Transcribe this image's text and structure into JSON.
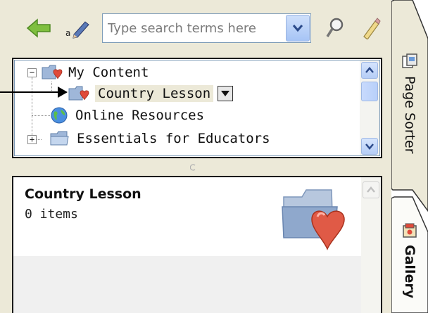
{
  "toolbar": {
    "back_icon": "back-arrow-icon",
    "rename_icon": "rename-pen-icon",
    "search": {
      "placeholder": "Type search terms here",
      "value": ""
    },
    "search_icon": "magnifier-icon",
    "clear_icon": "pencil-icon"
  },
  "tree": {
    "items": [
      {
        "label": "My Content",
        "icon": "folder-heart-icon",
        "expander": "−"
      },
      {
        "label": "Country Lesson",
        "icon": "folder-heart-icon",
        "selected": true
      },
      {
        "label": "Online Resources",
        "icon": "globe-icon"
      },
      {
        "label": "Essentials for Educators",
        "icon": "folder-icon",
        "expander": "+"
      }
    ]
  },
  "gallery": {
    "title": "Country Lesson",
    "count": "0 items",
    "icon": "folder-heart-icon"
  },
  "side_tabs": [
    {
      "label": "Page Sorter",
      "icon": "page-sorter-icon"
    },
    {
      "label": "Gallery",
      "icon": "gallery-icon"
    }
  ],
  "colors": {
    "panel_bg": "#ece9d8",
    "scroll_blue": "#b5cdf6",
    "heart_red": "#e04a3a",
    "folder_blue": "#7ea2cf"
  }
}
